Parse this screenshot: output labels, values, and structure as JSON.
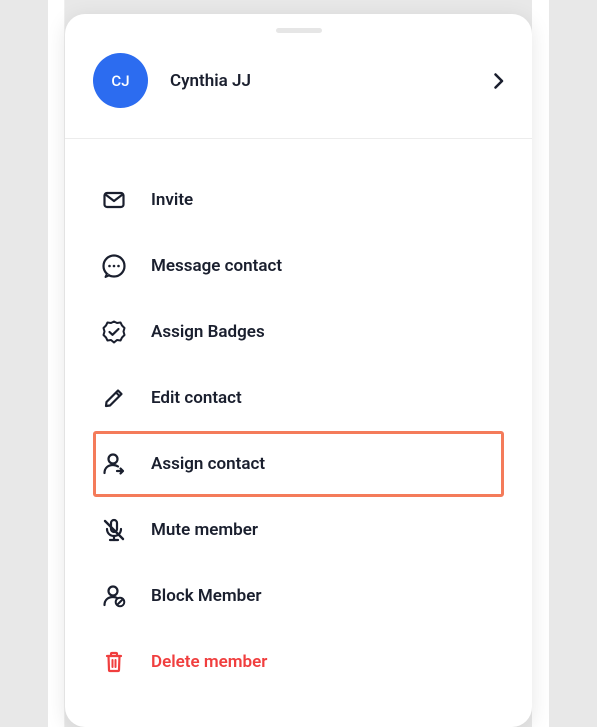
{
  "profile": {
    "initials": "CJ",
    "name": "Cynthia JJ"
  },
  "menu": {
    "items": [
      {
        "key": "invite",
        "label": "Invite",
        "highlighted": false,
        "danger": false
      },
      {
        "key": "message",
        "label": "Message contact",
        "highlighted": false,
        "danger": false
      },
      {
        "key": "badges",
        "label": "Assign Badges",
        "highlighted": false,
        "danger": false
      },
      {
        "key": "edit",
        "label": "Edit contact",
        "highlighted": false,
        "danger": false
      },
      {
        "key": "assign",
        "label": "Assign contact",
        "highlighted": true,
        "danger": false
      },
      {
        "key": "mute",
        "label": "Mute member",
        "highlighted": false,
        "danger": false
      },
      {
        "key": "block",
        "label": "Block Member",
        "highlighted": false,
        "danger": false
      },
      {
        "key": "delete",
        "label": "Delete member",
        "highlighted": false,
        "danger": true
      }
    ]
  },
  "colors": {
    "accent": "#2c6cf0",
    "danger": "#f03e3e",
    "highlight_border": "#f47b5a"
  }
}
